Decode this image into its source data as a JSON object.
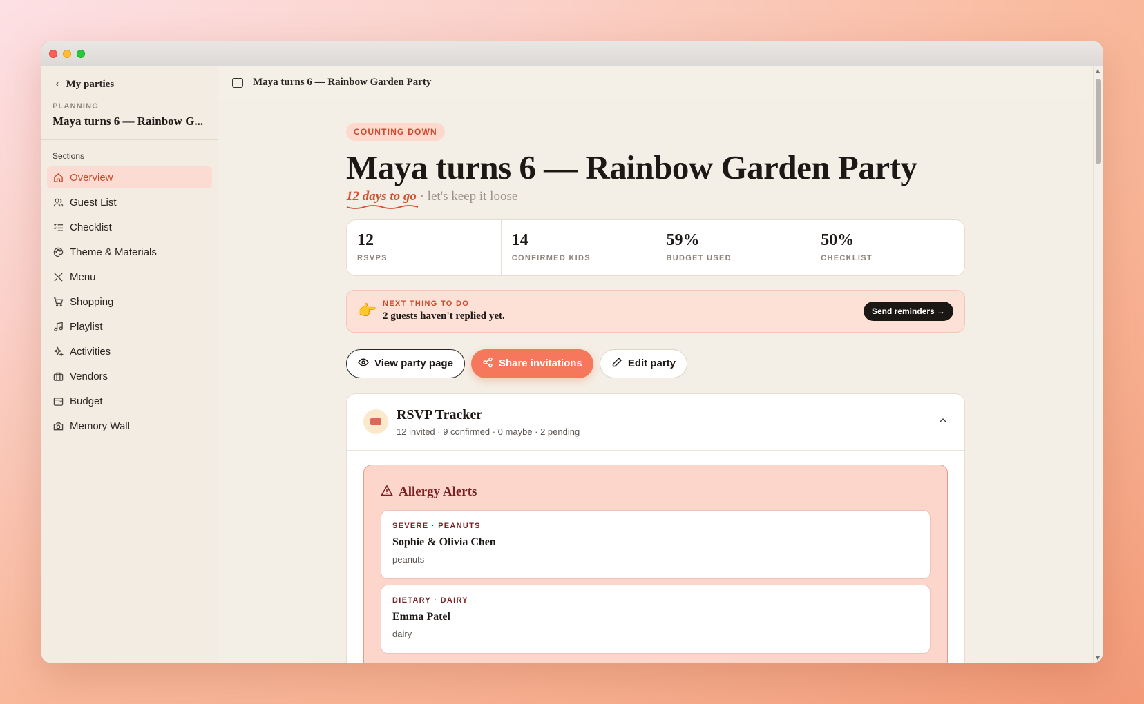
{
  "sidebar": {
    "back_label": "My parties",
    "planning_kicker": "PLANNING",
    "planning_title": "Maya turns 6 — Rainbow G...",
    "sections_label": "Sections",
    "items": [
      {
        "label": "Overview",
        "icon": "home-icon",
        "active": true
      },
      {
        "label": "Guest List",
        "icon": "users-icon"
      },
      {
        "label": "Checklist",
        "icon": "list-checks-icon"
      },
      {
        "label": "Theme & Materials",
        "icon": "palette-icon"
      },
      {
        "label": "Menu",
        "icon": "utensils-icon"
      },
      {
        "label": "Shopping",
        "icon": "cart-icon"
      },
      {
        "label": "Playlist",
        "icon": "music-icon"
      },
      {
        "label": "Activities",
        "icon": "sparkles-icon"
      },
      {
        "label": "Vendors",
        "icon": "briefcase-icon"
      },
      {
        "label": "Budget",
        "icon": "wallet-icon"
      },
      {
        "label": "Memory Wall",
        "icon": "camera-icon"
      }
    ]
  },
  "topbar": {
    "title": "Maya turns 6 — Rainbow Garden Party"
  },
  "hero": {
    "status_pill": "COUNTING DOWN",
    "title": "Maya turns 6 — Rainbow Garden Party",
    "countdown": "12 days to go",
    "tagline": " · let's keep it loose"
  },
  "stats": [
    {
      "value": "12",
      "label": "RSVPS"
    },
    {
      "value": "14",
      "label": "CONFIRMED KIDS"
    },
    {
      "value": "59%",
      "label": "BUDGET USED"
    },
    {
      "value": "50%",
      "label": "CHECKLIST"
    }
  ],
  "next_up": {
    "emoji": "👉",
    "kicker": "NEXT THING TO DO",
    "message": "2 guests haven't replied yet.",
    "button": "Send reminders →"
  },
  "actions": {
    "view": "View party page",
    "share": "Share invitations",
    "edit": "Edit party"
  },
  "rsvp": {
    "title": "RSVP Tracker",
    "summary": "12 invited · 9 confirmed · 0 maybe · 2 pending",
    "allergy_title": "Allergy Alerts",
    "alerts": [
      {
        "kicker": "SEVERE · PEANUTS",
        "name": "Sophie & Olivia Chen",
        "note": "peanuts"
      },
      {
        "kicker": "DIETARY · DAIRY",
        "name": "Emma Patel",
        "note": "dairy"
      }
    ]
  },
  "colors": {
    "accent": "#f5785c",
    "accent_text": "#c94a2c",
    "alert_text": "#7a1f22"
  }
}
